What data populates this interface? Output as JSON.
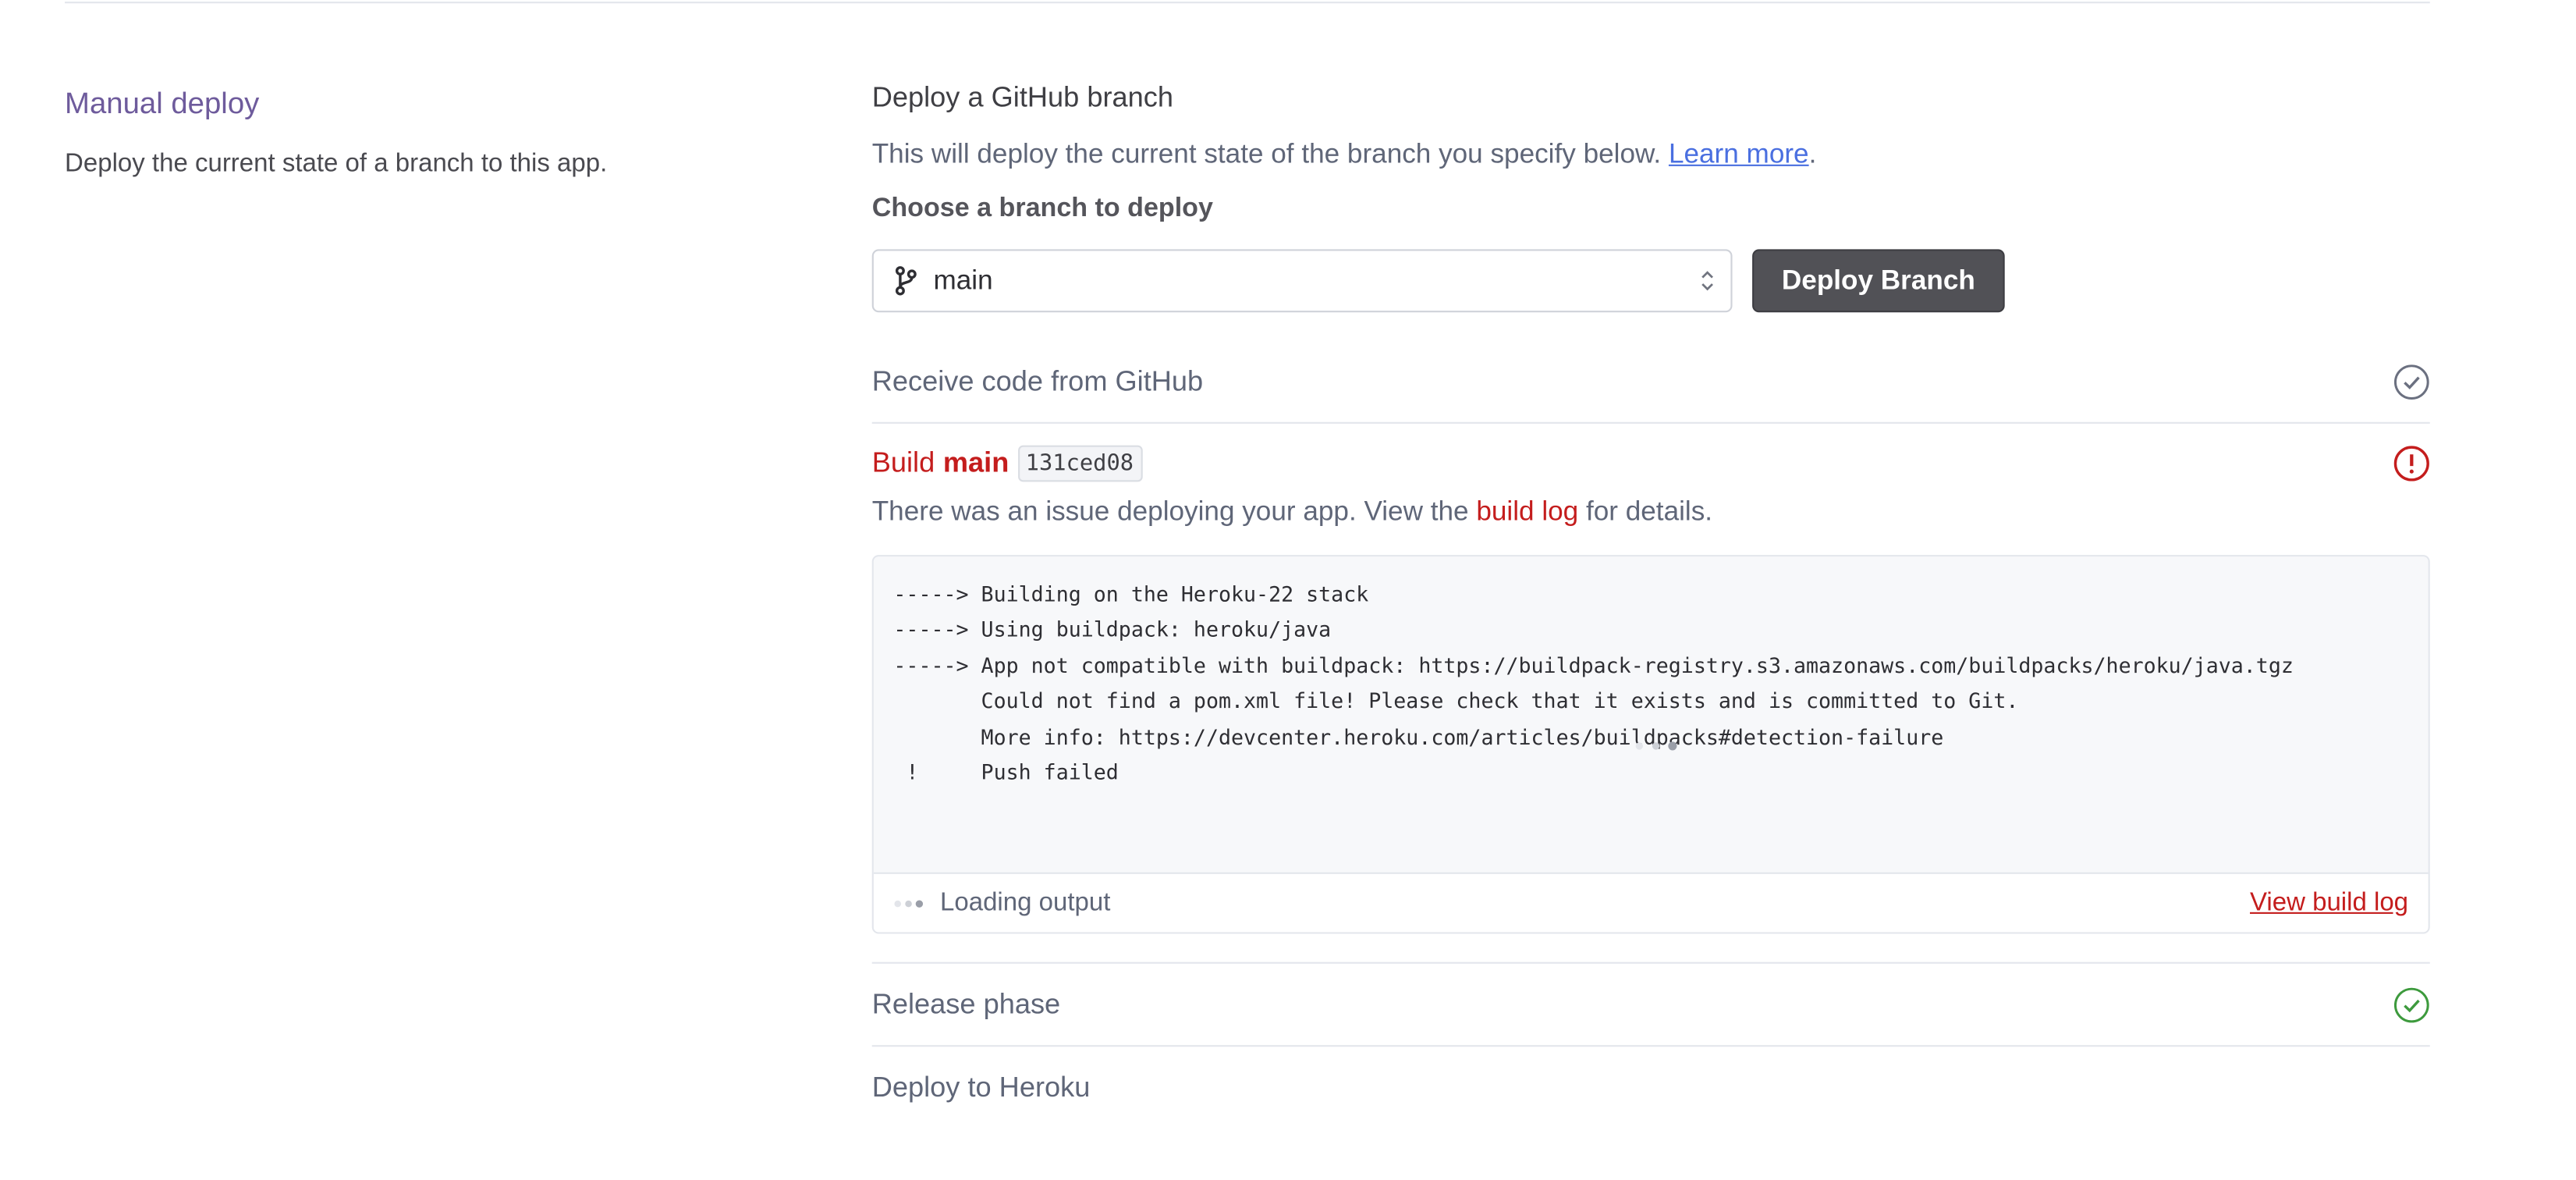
{
  "section": {
    "title": "Manual deploy",
    "description": "Deploy the current state of a branch to this app."
  },
  "github": {
    "heading": "Deploy a GitHub branch",
    "intro_text": "This will deploy the current state of the branch you specify below. ",
    "learn_more": "Learn more",
    "intro_end": ".",
    "choose_label": "Choose a branch to deploy",
    "branch_value": "main",
    "deploy_button": "Deploy Branch"
  },
  "steps": {
    "receive": "Receive code from GitHub",
    "build_word": "Build",
    "build_branch": "main",
    "build_commit": "131ced08",
    "build_msg_pre": "There was an issue deploying your app. View the ",
    "build_msg_link": "build log",
    "build_msg_post": " for details.",
    "release": "Release phase",
    "deploy": "Deploy to Heroku"
  },
  "log": {
    "lines": [
      "-----> Building on the Heroku-22 stack",
      "-----> Using buildpack: heroku/java",
      "-----> App not compatible with buildpack: https://buildpack-registry.s3.amazonaws.com/buildpacks/heroku/java.tgz",
      "       Could not find a pom.xml file! Please check that it exists and is committed to Git.",
      "       More info: https://devcenter.heroku.com/articles/buildpacks#detection-failure",
      " !     Push failed"
    ],
    "loading_text": "Loading output",
    "view_build_log": "View build log"
  },
  "icons": {
    "branch": "git-branch-icon",
    "select": "chevron-up-down-icon",
    "receive_status": "check-circle-icon",
    "build_status": "error-circle-icon",
    "release_status": "check-circle-icon",
    "loading": "loading-dots-icon"
  },
  "colors": {
    "section_title": "#6e5b9c",
    "error": "#c41d1d",
    "link": "#4a6fe0",
    "success": "#3d9a3d",
    "neutral_check": "#6b7080",
    "button_bg": "#515156"
  }
}
